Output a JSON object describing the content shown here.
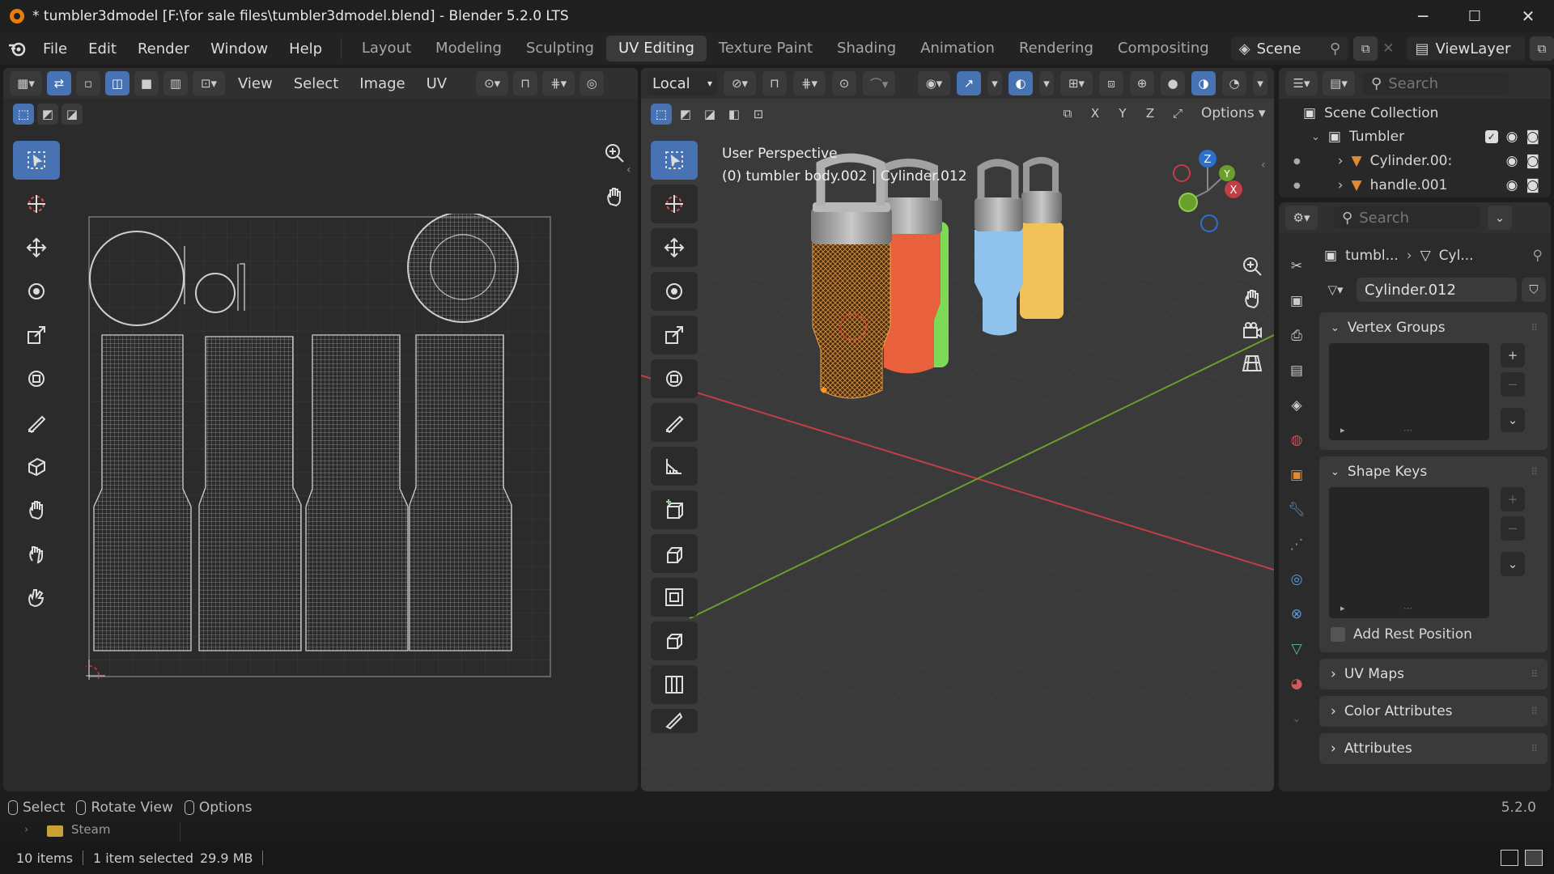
{
  "window": {
    "title": "* tumbler3dmodel [F:\\for sale files\\tumbler3dmodel.blend] - Blender 5.2.0 LTS",
    "minimize": "─",
    "maximize": "☐",
    "close": "✕"
  },
  "menu": [
    "File",
    "Edit",
    "Render",
    "Window",
    "Help"
  ],
  "workspaces": [
    "Layout",
    "Modeling",
    "Sculpting",
    "UV Editing",
    "Texture Paint",
    "Shading",
    "Animation",
    "Rendering",
    "Compositing"
  ],
  "active_workspace": "UV Editing",
  "scene": {
    "label": "Scene",
    "viewlayer": "ViewLayer"
  },
  "uv_editor": {
    "menus": [
      "View",
      "Select",
      "Image",
      "UV"
    ]
  },
  "viewport": {
    "orientation": "Local",
    "options_label": "Options",
    "axes": [
      "X",
      "Y",
      "Z"
    ],
    "info_line1": "User Perspective",
    "info_line2": "(0) tumbler body.002 | Cylinder.012",
    "gizmo": {
      "x": "X",
      "y": "Y",
      "z": "Z"
    }
  },
  "outliner": {
    "search_placeholder": "Search",
    "root": "Scene Collection",
    "collection": "Tumbler",
    "items": [
      "Cylinder.00:",
      "handle.001"
    ]
  },
  "properties": {
    "search_placeholder": "Search",
    "breadcrumb_obj": "tumbl...",
    "breadcrumb_data": "Cyl...",
    "data_name": "Cylinder.012",
    "sections": {
      "vertex_groups": "Vertex Groups",
      "shape_keys": "Shape Keys",
      "add_rest_position": "Add Rest Position",
      "uv_maps": "UV Maps",
      "color_attributes": "Color Attributes",
      "attributes": "Attributes"
    }
  },
  "status": {
    "select": "Select",
    "rotate": "Rotate View",
    "options": "Options",
    "version": "5.2.0"
  },
  "filebrowser_peek": "Steam",
  "info": {
    "items": "10 items",
    "selected": "1 item selected",
    "size": "29.9 MB"
  },
  "colors": {
    "accent": "#4772b3",
    "tumbler_orange": "#e8603c",
    "tumbler_green": "#7ed957",
    "tumbler_blue": "#8fc3ee",
    "tumbler_yellow": "#f0c35a",
    "axis_x": "#c33d44",
    "axis_y": "#6b9f2c"
  }
}
